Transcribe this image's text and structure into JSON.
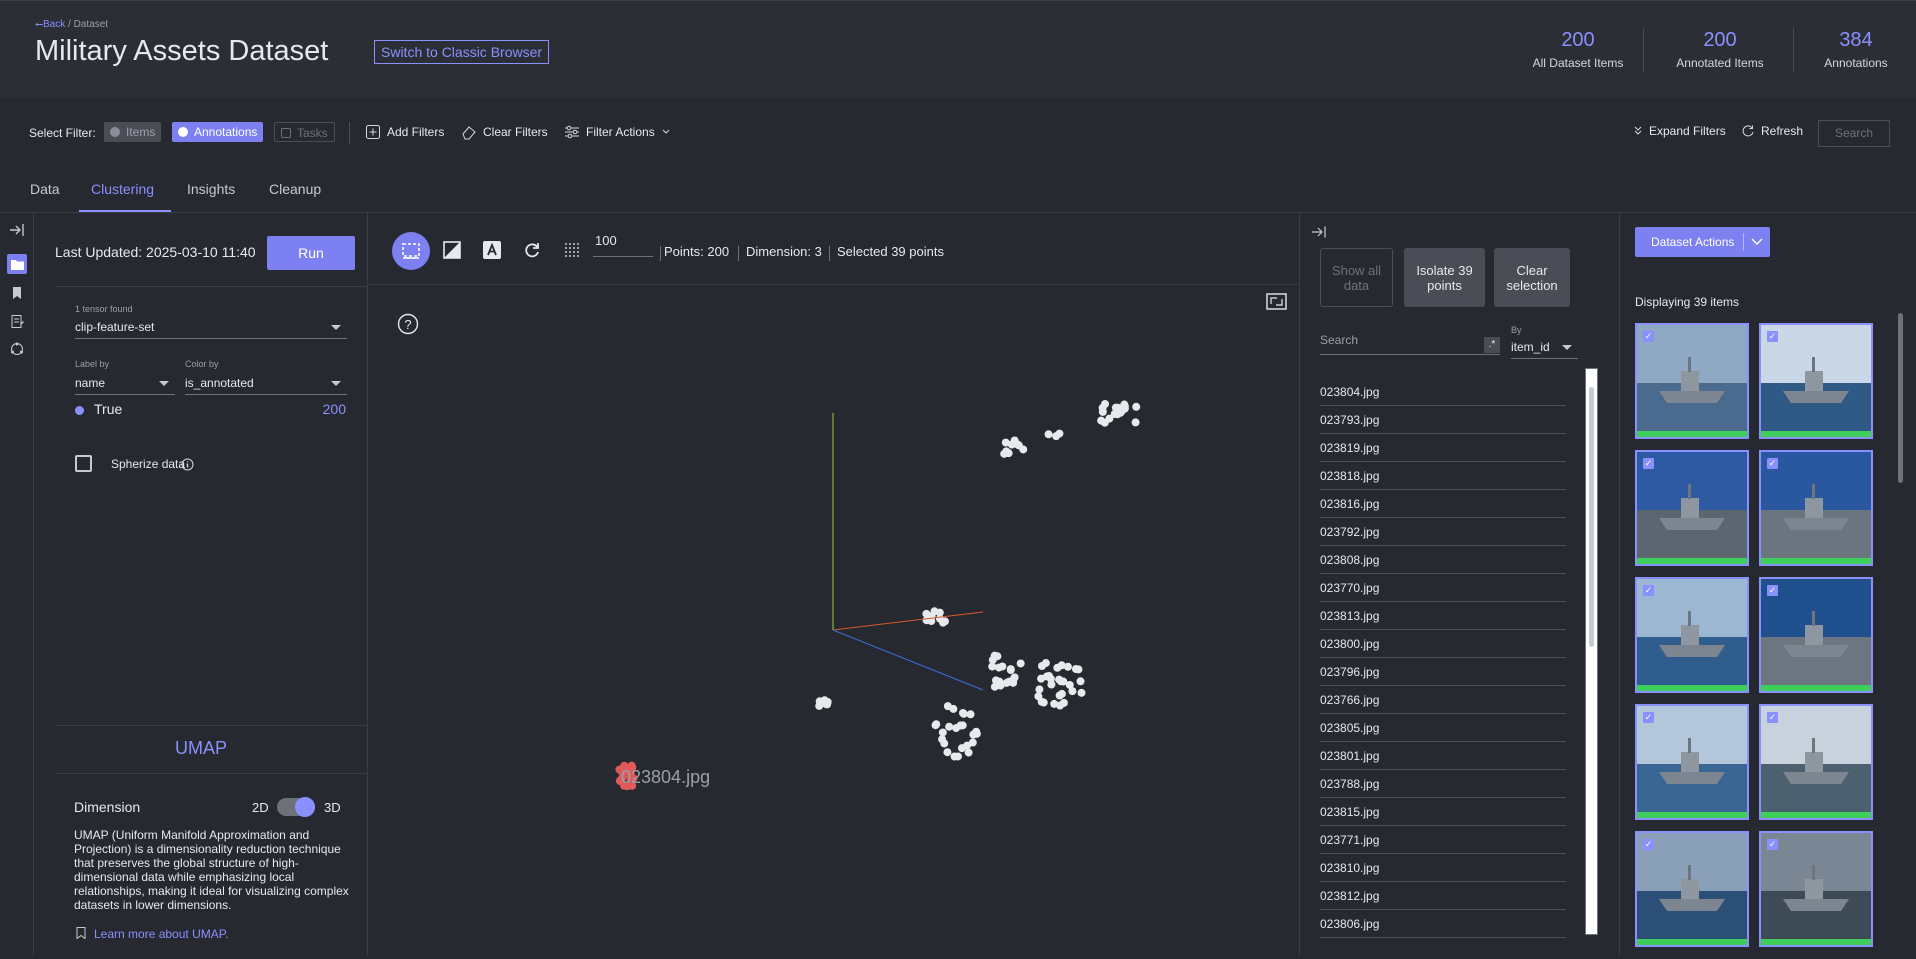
{
  "header": {
    "back_label": "⭠Back",
    "breadcrumb_sep": "/",
    "breadcrumb_current": "Dataset",
    "title": "Military Assets Dataset",
    "classic_button": "Switch to Classic Browser",
    "stats": [
      {
        "value": "200",
        "label": "All Dataset Items"
      },
      {
        "value": "200",
        "label": "Annotated Items"
      },
      {
        "value": "384",
        "label": "Annotations"
      }
    ]
  },
  "filter_bar": {
    "label": "Select Filter:",
    "chips": {
      "items": "Items",
      "annotations": "Annotations",
      "tasks": "Tasks"
    },
    "add_filters": "Add Filters",
    "clear_filters": "Clear Filters",
    "filter_actions": "Filter Actions",
    "expand_filters": "Expand Filters",
    "refresh": "Refresh",
    "search": "Search"
  },
  "tabs": [
    "Data",
    "Clustering",
    "Insights",
    "Cleanup"
  ],
  "active_tab": "Clustering",
  "left_panel": {
    "last_updated": "Last Updated: 2025-03-10 11:40",
    "run_button": "Run",
    "tensor_found": "1 tensor found",
    "tensor_value": "clip-feature-set",
    "label_by_label": "Label by",
    "label_by_value": "name",
    "color_by_label": "Color by",
    "color_by_value": "is_annotated",
    "legend_label": "True",
    "legend_count": "200",
    "spherize_label": "Spherize data",
    "umap_title": "UMAP",
    "dimension_label": "Dimension",
    "dim_2d": "2D",
    "dim_3d": "3D",
    "umap_description": "UMAP (Uniform Manifold Approximation and Projection) is a dimensionality reduction technique that preserves the global structure of high-dimensional data while emphasizing local relationships, making it ideal for visualizing complex datasets in lower dimensions.",
    "learn_more": "Learn more about UMAP."
  },
  "viz": {
    "neighbors_value": "100",
    "points": "Points: 200",
    "dimension": "Dimension: 3",
    "selected": "Selected 39 points",
    "hover_label": "023804.jpg",
    "accent_color": "#7c80f0",
    "selected_color": "#e05a5a"
  },
  "right_list": {
    "show_all": "Show all data",
    "isolate": "Isolate 39 points",
    "clear_selection": "Clear selection",
    "search_placeholder": "Search",
    "regex_label": ".*",
    "by_label": "By",
    "by_value": "item_id",
    "items": [
      "023804.jpg",
      "023793.jpg",
      "023819.jpg",
      "023818.jpg",
      "023816.jpg",
      "023792.jpg",
      "023808.jpg",
      "023770.jpg",
      "023813.jpg",
      "023800.jpg",
      "023796.jpg",
      "023766.jpg",
      "023805.jpg",
      "023801.jpg",
      "023788.jpg",
      "023815.jpg",
      "023771.jpg",
      "023810.jpg",
      "023812.jpg",
      "023806.jpg"
    ]
  },
  "gallery": {
    "dataset_actions": "Dataset Actions",
    "displaying": "Displaying 39 items",
    "tile_count": 10,
    "annotation_bar_color": "#3ecf5a"
  }
}
